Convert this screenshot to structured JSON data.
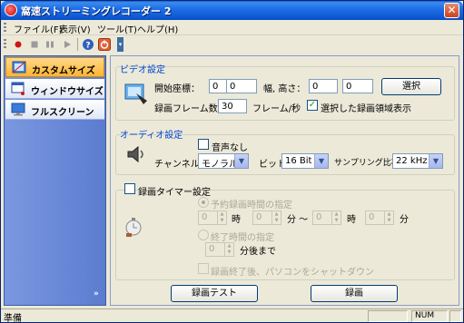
{
  "window": {
    "title": "窩速ストリーミングレコーダー 2"
  },
  "menu": [
    {
      "label": "ファイル(F)"
    },
    {
      "label": "表示(V)"
    },
    {
      "label": "ツール(T)"
    },
    {
      "label": "ヘルプ(H)"
    }
  ],
  "toolbar": {
    "buttons": [
      "record-icon",
      "stop-icon",
      "pause-icon",
      "play-icon",
      "help-icon",
      "power-icon"
    ]
  },
  "sidebar": {
    "items": [
      {
        "label": "カスタムサイズ",
        "active": true,
        "icon": "custom-size-icon"
      },
      {
        "label": "ウィンドウサイズ",
        "active": false,
        "icon": "window-size-icon"
      },
      {
        "label": "フルスクリーン",
        "active": false,
        "icon": "fullscreen-icon"
      }
    ],
    "expand": "»"
  },
  "video": {
    "title": "ビデオ設定",
    "start_label": "開始座標：",
    "start_x": "0",
    "start_y": "0",
    "size_label": "幅, 高さ：",
    "width": "0",
    "height": "0",
    "select_button": "選択",
    "fps_label": "録画フレーム数：",
    "fps_value": "30",
    "fps_unit": "フレーム/秒",
    "show_region_label": "選択した録画領域表示",
    "show_region_checked": true
  },
  "audio": {
    "title": "オーディオ設定",
    "mute_label": "音声なし",
    "mute_checked": false,
    "channel_label": "チャンネル：",
    "channel_value": "モノラル",
    "bit_label": "ビット：",
    "bit_value": "16 Bit",
    "sample_label": "サンプリング比率：",
    "sample_value": "22 kHz"
  },
  "timer": {
    "title": "録画タイマー設定",
    "enabled": false,
    "scheduled_label": "予約録画時間の指定",
    "from_hour": "0",
    "hour_unit": "時",
    "from_min": "0",
    "min_unit": "分 〜",
    "to_hour": "0",
    "to_hour_unit": "時",
    "to_min": "0",
    "to_min_unit": "分",
    "end_time_label": "終了時間の指定",
    "end_after": "0",
    "end_after_unit": "分後まで",
    "shutdown_label": "録画終了後、パソコンをシャットダウン"
  },
  "buttons": {
    "test": "録画テスト",
    "record": "録画"
  },
  "status": {
    "text": "準備",
    "num": "NUM"
  }
}
